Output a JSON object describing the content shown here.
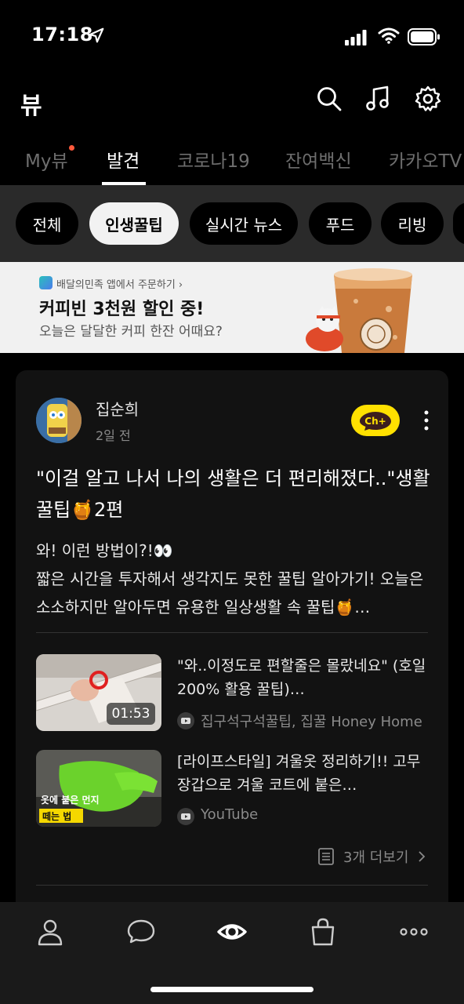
{
  "status": {
    "time": "17:18"
  },
  "header": {
    "title": "뷰"
  },
  "tabs": [
    {
      "label": "My뷰"
    },
    {
      "label": "발견"
    },
    {
      "label": "코로나19"
    },
    {
      "label": "잔여백신"
    },
    {
      "label": "카카오TV"
    }
  ],
  "chips": [
    {
      "label": "전체"
    },
    {
      "label": "인생꿀팁"
    },
    {
      "label": "실시간 뉴스"
    },
    {
      "label": "푸드"
    },
    {
      "label": "리빙"
    }
  ],
  "banner": {
    "source": "배달의민족 앱에서 주문하기 ›",
    "headline": "커피빈 3천원 할인 중!",
    "subtext": "오늘은 달달한 커피 한잔 어때요?"
  },
  "post": {
    "author": "집순희",
    "time": "2일 전",
    "channel_button": "Ch+",
    "title": "\"이걸 알고 나서 나의 생활은 더 편리해졌다..\"생활 꿀팁🍯2편",
    "body": "와! 이런 방법이?!👀\n짧은 시간을 투자해서 생각지도 못한 꿀팁 알아가기! 오늘은 소소하지만 알아두면 유용한 일상생활 속 꿀팁🍯…",
    "items": [
      {
        "title": "\"와..이정도로 편할줄은 몰랐네요\" (호일 200% 활용 꿀팁)…",
        "duration": "01:53",
        "source": "집구석구석꿀팁, 집꿀 Honey Home"
      },
      {
        "title": "[라이프스타일] 겨울옷 정리하기!! 고무장갑으로 겨울 코트에 붙은…",
        "thumb_caption_1": "옷에 붙은 먼지",
        "thumb_caption_2": "떼는 법",
        "source": "YouTube"
      }
    ],
    "more_label": "3개 더보기"
  },
  "colors": {
    "accent": "#ffe100",
    "notification_dot": "#ff5a3c"
  }
}
